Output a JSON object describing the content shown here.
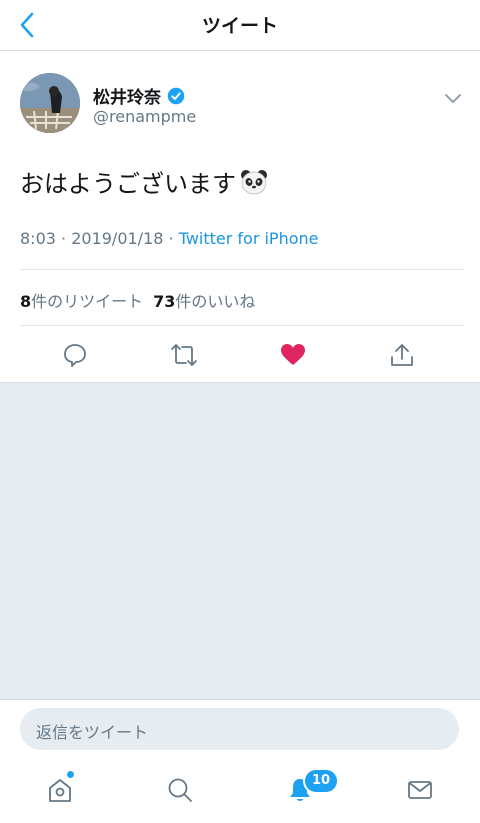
{
  "header": {
    "title": "ツイート"
  },
  "tweet": {
    "display_name": "松井玲奈",
    "handle": "@renampme",
    "text": "おはようございます",
    "time": "8:03",
    "separator": " · ",
    "date": "2019/01/18",
    "source": "Twitter for iPhone",
    "retweets_count": "8",
    "retweets_label": "件のリツイート",
    "likes_count": "73",
    "likes_label": "件のいいね",
    "liked": true
  },
  "reply": {
    "placeholder": "返信をツイート"
  },
  "tabbar": {
    "notifications_badge": "10"
  },
  "colors": {
    "accent": "#1da1f2",
    "like": "#e0245e",
    "secondary_text": "#657786",
    "background_gray": "#e6ecf0"
  }
}
